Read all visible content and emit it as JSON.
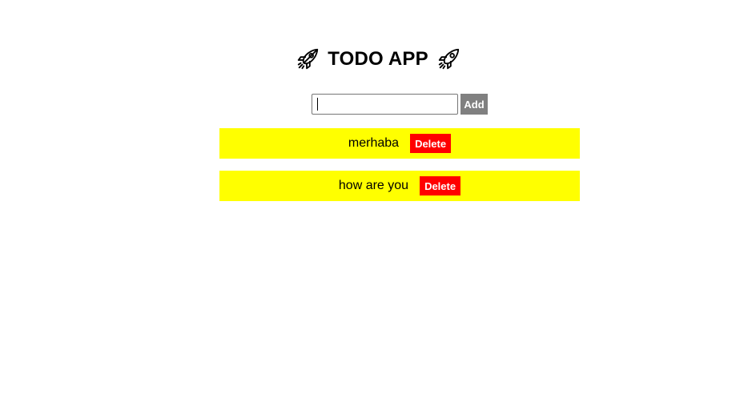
{
  "header": {
    "title": "TODO APP",
    "left_icon": "rocket-icon",
    "right_icon": "rocket-icon"
  },
  "form": {
    "input_value": "",
    "add_label": "Add"
  },
  "todos": [
    {
      "text": "merhaba",
      "delete_label": "Delete"
    },
    {
      "text": "how are you",
      "delete_label": "Delete"
    }
  ],
  "colors": {
    "item_background": "#ffff00",
    "delete_button": "#ff0000",
    "add_button": "#808080"
  }
}
